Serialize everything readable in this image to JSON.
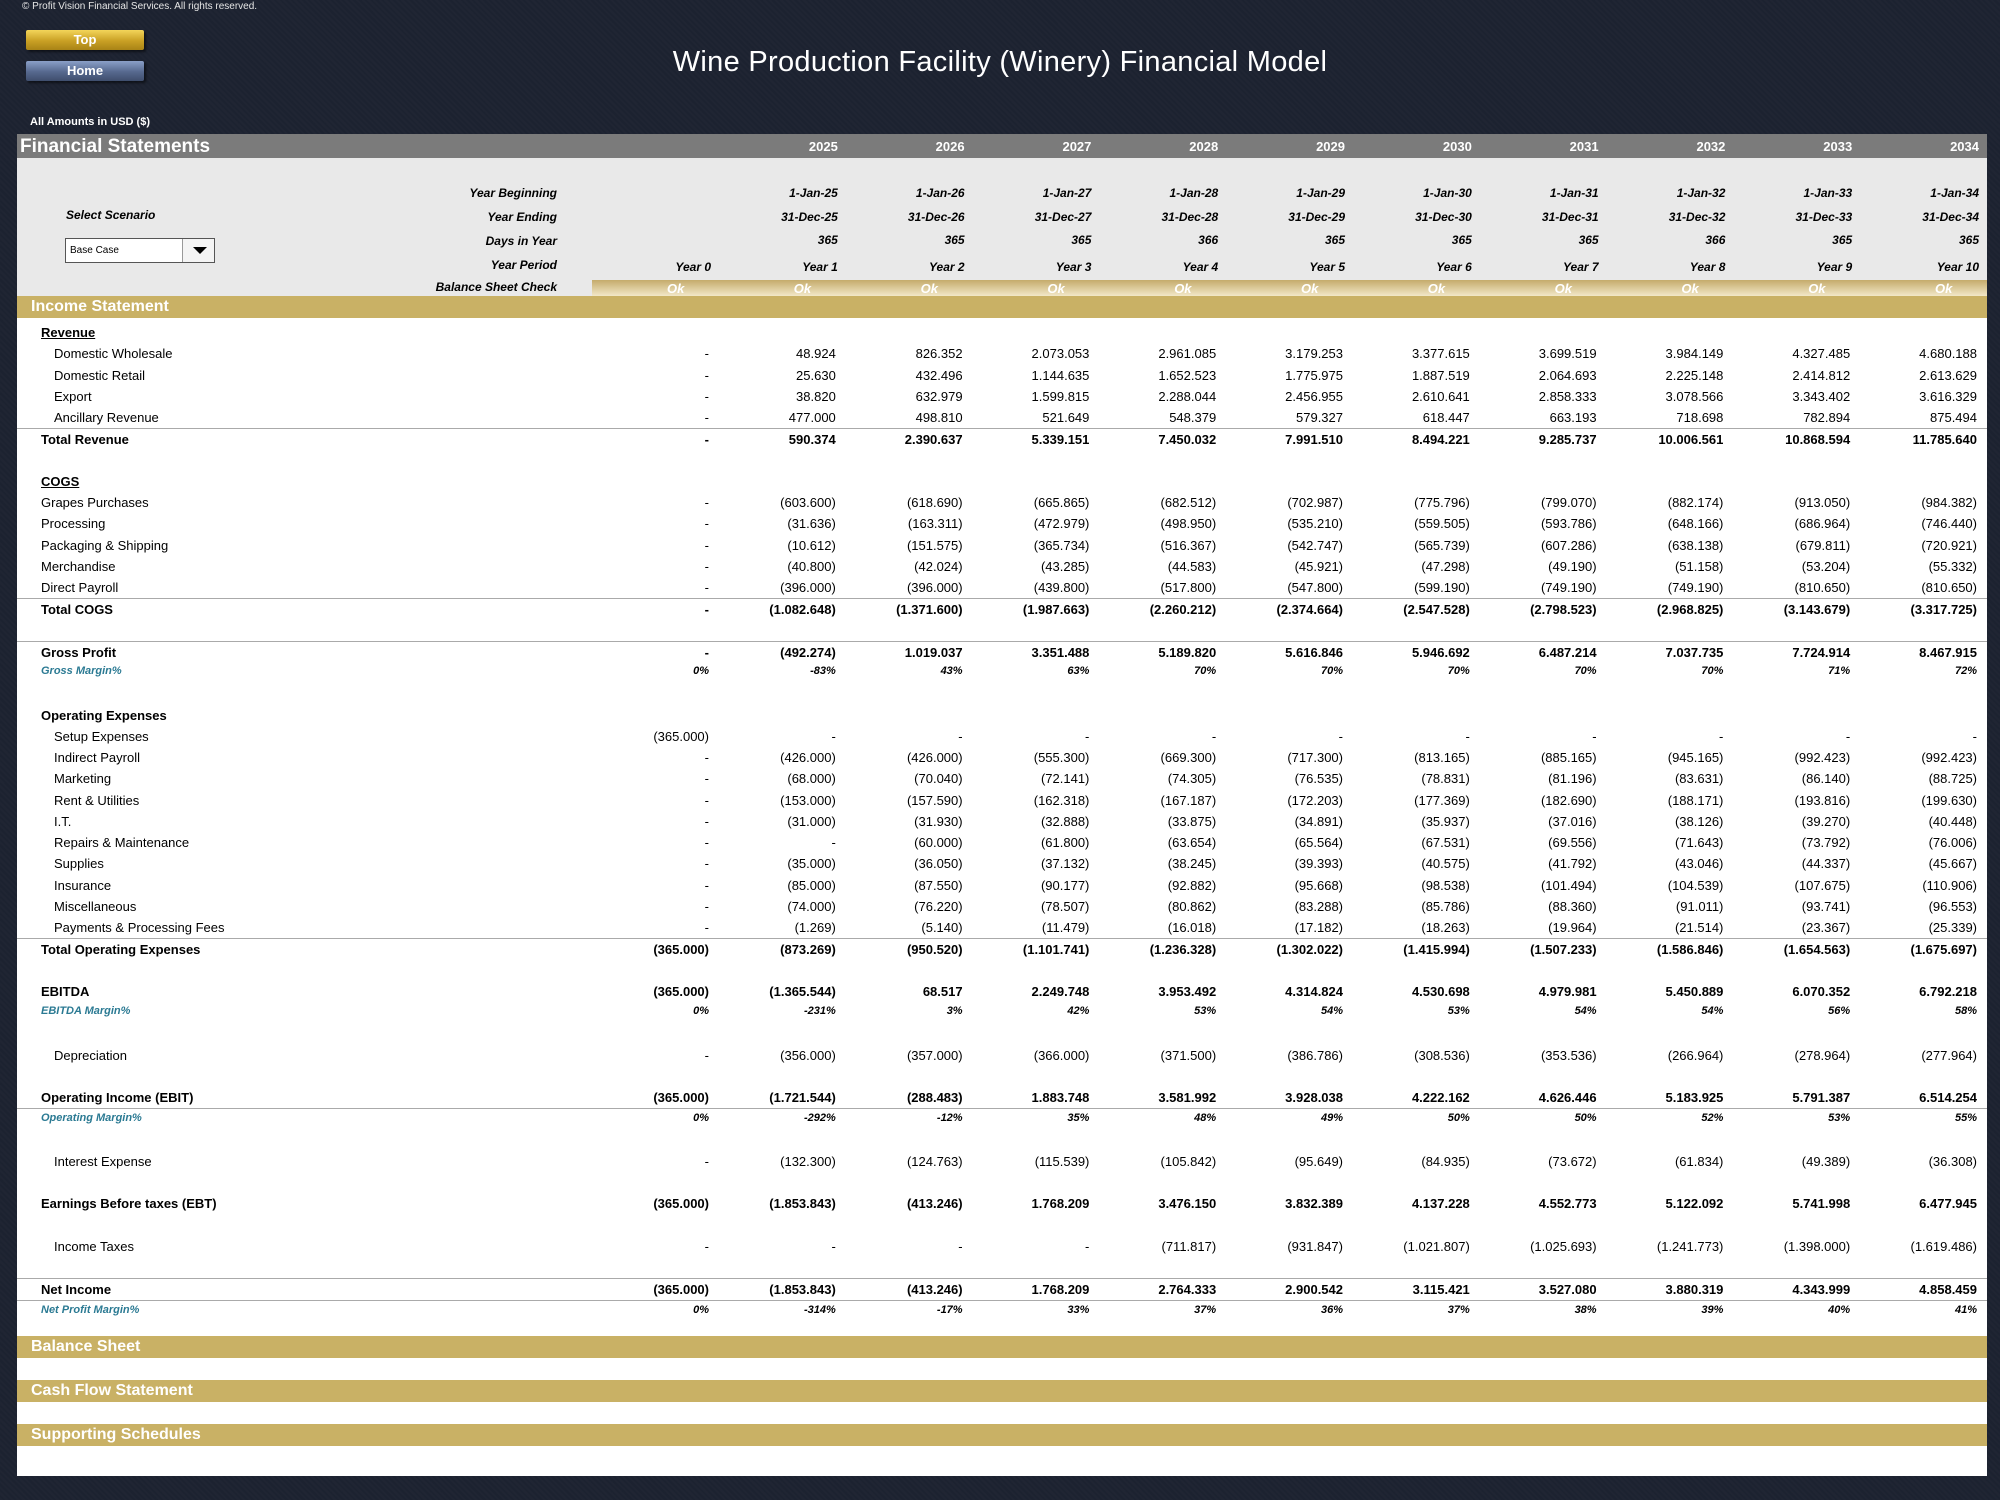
{
  "copyright": "© Profit Vision Financial Services. All rights reserved.",
  "nav": {
    "top": "Top",
    "home": "Home"
  },
  "title": "Wine Production Facility (Winery) Financial Model",
  "amounts_note": "All Amounts in  USD ($)",
  "header": {
    "section": "Financial Statements",
    "years": [
      "2025",
      "2026",
      "2027",
      "2028",
      "2029",
      "2030",
      "2031",
      "2032",
      "2033",
      "2034"
    ],
    "labels": {
      "year_beginning": "Year Beginning",
      "year_ending": "Year Ending",
      "days_in_year": "Days in Year",
      "year_period": "Year Period",
      "bs_check": "Balance Sheet Check",
      "select_scenario": "Select Scenario"
    },
    "year_beginning": [
      "1-Jan-25",
      "1-Jan-26",
      "1-Jan-27",
      "1-Jan-28",
      "1-Jan-29",
      "1-Jan-30",
      "1-Jan-31",
      "1-Jan-32",
      "1-Jan-33",
      "1-Jan-34"
    ],
    "year_ending": [
      "31-Dec-25",
      "31-Dec-26",
      "31-Dec-27",
      "31-Dec-28",
      "31-Dec-29",
      "31-Dec-30",
      "31-Dec-31",
      "31-Dec-32",
      "31-Dec-33",
      "31-Dec-34"
    ],
    "days": [
      "365",
      "365",
      "365",
      "366",
      "365",
      "365",
      "365",
      "366",
      "365",
      "365"
    ],
    "periods": [
      "Year 0",
      "Year 1",
      "Year 2",
      "Year 3",
      "Year 4",
      "Year 5",
      "Year 6",
      "Year 7",
      "Year 8",
      "Year 9",
      "Year 10"
    ],
    "checks": [
      "Ok",
      "Ok",
      "Ok",
      "Ok",
      "Ok",
      "Ok",
      "Ok",
      "Ok",
      "Ok",
      "Ok",
      "Ok"
    ],
    "scenario_value": "Base Case"
  },
  "income_statement": {
    "title": "Income Statement",
    "rows": [
      {
        "label": "Revenue",
        "style": "subhead"
      },
      {
        "label": "Domestic Wholesale",
        "style": "item",
        "values": [
          "-",
          "48.924",
          "826.352",
          "2.073.053",
          "2.961.085",
          "3.179.253",
          "3.377.615",
          "3.699.519",
          "3.984.149",
          "4.327.485",
          "4.680.188"
        ]
      },
      {
        "label": "Domestic Retail",
        "style": "item",
        "values": [
          "-",
          "25.630",
          "432.496",
          "1.144.635",
          "1.652.523",
          "1.775.975",
          "1.887.519",
          "2.064.693",
          "2.225.148",
          "2.414.812",
          "2.613.629"
        ]
      },
      {
        "label": "Export",
        "style": "item",
        "values": [
          "-",
          "38.820",
          "632.979",
          "1.599.815",
          "2.288.044",
          "2.456.955",
          "2.610.641",
          "2.858.333",
          "3.078.566",
          "3.343.402",
          "3.616.329"
        ]
      },
      {
        "label": "Ancillary Revenue",
        "style": "item",
        "values": [
          "-",
          "477.000",
          "498.810",
          "521.649",
          "548.379",
          "579.327",
          "618.447",
          "663.193",
          "718.698",
          "782.894",
          "875.494"
        ]
      },
      {
        "label": "Total Revenue",
        "style": "total",
        "values": [
          "-",
          "590.374",
          "2.390.637",
          "5.339.151",
          "7.450.032",
          "7.991.510",
          "8.494.221",
          "9.285.737",
          "10.006.561",
          "10.868.594",
          "11.785.640"
        ]
      },
      {
        "style": "blank"
      },
      {
        "label": "COGS",
        "style": "subhead"
      },
      {
        "label": "Grapes Purchases",
        "style": "flat",
        "values": [
          "-",
          "(603.600)",
          "(618.690)",
          "(665.865)",
          "(682.512)",
          "(702.987)",
          "(775.796)",
          "(799.070)",
          "(882.174)",
          "(913.050)",
          "(984.382)"
        ]
      },
      {
        "label": "Processing",
        "style": "flat",
        "values": [
          "-",
          "(31.636)",
          "(163.311)",
          "(472.979)",
          "(498.950)",
          "(535.210)",
          "(559.505)",
          "(593.786)",
          "(648.166)",
          "(686.964)",
          "(746.440)"
        ]
      },
      {
        "label": "Packaging & Shipping",
        "style": "flat",
        "values": [
          "-",
          "(10.612)",
          "(151.575)",
          "(365.734)",
          "(516.367)",
          "(542.747)",
          "(565.739)",
          "(607.286)",
          "(638.138)",
          "(679.811)",
          "(720.921)"
        ]
      },
      {
        "label": "Merchandise",
        "style": "flat",
        "values": [
          "-",
          "(40.800)",
          "(42.024)",
          "(43.285)",
          "(44.583)",
          "(45.921)",
          "(47.298)",
          "(49.190)",
          "(51.158)",
          "(53.204)",
          "(55.332)"
        ]
      },
      {
        "label": "Direct Payroll",
        "style": "flat",
        "values": [
          "-",
          "(396.000)",
          "(396.000)",
          "(439.800)",
          "(517.800)",
          "(547.800)",
          "(599.190)",
          "(749.190)",
          "(749.190)",
          "(810.650)",
          "(810.650)"
        ]
      },
      {
        "label": "Total COGS",
        "style": "total",
        "values": [
          "-",
          "(1.082.648)",
          "(1.371.600)",
          "(1.987.663)",
          "(2.260.212)",
          "(2.374.664)",
          "(2.547.528)",
          "(2.798.523)",
          "(2.968.825)",
          "(3.143.679)",
          "(3.317.725)"
        ]
      },
      {
        "style": "blank"
      },
      {
        "label": "Gross Profit",
        "style": "total",
        "values": [
          "-",
          "(492.274)",
          "1.019.037",
          "3.351.488",
          "5.189.820",
          "5.616.846",
          "5.946.692",
          "6.487.214",
          "7.037.735",
          "7.724.914",
          "8.467.915"
        ]
      },
      {
        "label": "Gross Margin%",
        "style": "pct",
        "values": [
          "0%",
          "-83%",
          "43%",
          "63%",
          "70%",
          "70%",
          "70%",
          "70%",
          "70%",
          "71%",
          "72%"
        ]
      },
      {
        "style": "blank"
      },
      {
        "label": "Operating Expenses",
        "style": "boldhead"
      },
      {
        "label": "Setup Expenses",
        "style": "item",
        "values": [
          "(365.000)",
          "-",
          "-",
          "-",
          "-",
          "-",
          "-",
          "-",
          "-",
          "-",
          "-"
        ]
      },
      {
        "label": "Indirect Payroll",
        "style": "item",
        "values": [
          "-",
          "(426.000)",
          "(426.000)",
          "(555.300)",
          "(669.300)",
          "(717.300)",
          "(813.165)",
          "(885.165)",
          "(945.165)",
          "(992.423)",
          "(992.423)"
        ]
      },
      {
        "label": "Marketing",
        "style": "item",
        "values": [
          "-",
          "(68.000)",
          "(70.040)",
          "(72.141)",
          "(74.305)",
          "(76.535)",
          "(78.831)",
          "(81.196)",
          "(83.631)",
          "(86.140)",
          "(88.725)"
        ]
      },
      {
        "label": "Rent & Utilities",
        "style": "item",
        "values": [
          "-",
          "(153.000)",
          "(157.590)",
          "(162.318)",
          "(167.187)",
          "(172.203)",
          "(177.369)",
          "(182.690)",
          "(188.171)",
          "(193.816)",
          "(199.630)"
        ]
      },
      {
        "label": "I.T.",
        "style": "item",
        "values": [
          "-",
          "(31.000)",
          "(31.930)",
          "(32.888)",
          "(33.875)",
          "(34.891)",
          "(35.937)",
          "(37.016)",
          "(38.126)",
          "(39.270)",
          "(40.448)"
        ]
      },
      {
        "label": "Repairs & Maintenance",
        "style": "item",
        "values": [
          "-",
          "-",
          "(60.000)",
          "(61.800)",
          "(63.654)",
          "(65.564)",
          "(67.531)",
          "(69.556)",
          "(71.643)",
          "(73.792)",
          "(76.006)"
        ]
      },
      {
        "label": "Supplies",
        "style": "item",
        "values": [
          "-",
          "(35.000)",
          "(36.050)",
          "(37.132)",
          "(38.245)",
          "(39.393)",
          "(40.575)",
          "(41.792)",
          "(43.046)",
          "(44.337)",
          "(45.667)"
        ]
      },
      {
        "label": "Insurance",
        "style": "item",
        "values": [
          "-",
          "(85.000)",
          "(87.550)",
          "(90.177)",
          "(92.882)",
          "(95.668)",
          "(98.538)",
          "(101.494)",
          "(104.539)",
          "(107.675)",
          "(110.906)"
        ]
      },
      {
        "label": "Miscellaneous",
        "style": "item",
        "values": [
          "-",
          "(74.000)",
          "(76.220)",
          "(78.507)",
          "(80.862)",
          "(83.288)",
          "(85.786)",
          "(88.360)",
          "(91.011)",
          "(93.741)",
          "(96.553)"
        ]
      },
      {
        "label": "Payments & Processing Fees",
        "style": "item",
        "values": [
          "-",
          "(1.269)",
          "(5.140)",
          "(11.479)",
          "(16.018)",
          "(17.182)",
          "(18.263)",
          "(19.964)",
          "(21.514)",
          "(23.367)",
          "(25.339)"
        ]
      },
      {
        "label": "Total Operating Expenses",
        "style": "total",
        "values": [
          "(365.000)",
          "(873.269)",
          "(950.520)",
          "(1.101.741)",
          "(1.236.328)",
          "(1.302.022)",
          "(1.415.994)",
          "(1.507.233)",
          "(1.586.846)",
          "(1.654.563)",
          "(1.675.697)"
        ]
      },
      {
        "style": "blank"
      },
      {
        "label": "EBITDA",
        "style": "boldrow",
        "values": [
          "(365.000)",
          "(1.365.544)",
          "68.517",
          "2.249.748",
          "3.953.492",
          "4.314.824",
          "4.530.698",
          "4.979.981",
          "5.450.889",
          "6.070.352",
          "6.792.218"
        ]
      },
      {
        "label": "EBITDA Margin%",
        "style": "pct",
        "values": [
          "0%",
          "-231%",
          "3%",
          "42%",
          "53%",
          "54%",
          "53%",
          "54%",
          "54%",
          "56%",
          "58%"
        ]
      },
      {
        "style": "blank"
      },
      {
        "label": "Depreciation",
        "style": "item",
        "values": [
          "-",
          "(356.000)",
          "(357.000)",
          "(366.000)",
          "(371.500)",
          "(386.786)",
          "(308.536)",
          "(353.536)",
          "(266.964)",
          "(278.964)",
          "(277.964)"
        ]
      },
      {
        "style": "blank"
      },
      {
        "label": "Operating Income (EBIT)",
        "style": "boldrow",
        "values": [
          "(365.000)",
          "(1.721.544)",
          "(288.483)",
          "1.883.748",
          "3.581.992",
          "3.928.038",
          "4.222.162",
          "4.626.446",
          "5.183.925",
          "5.791.387",
          "6.514.254"
        ]
      },
      {
        "label": "Operating Margin%",
        "style": "pctline",
        "values": [
          "0%",
          "-292%",
          "-12%",
          "35%",
          "48%",
          "49%",
          "50%",
          "50%",
          "52%",
          "53%",
          "55%"
        ]
      },
      {
        "style": "blank"
      },
      {
        "label": "Interest Expense",
        "style": "item",
        "values": [
          "-",
          "(132.300)",
          "(124.763)",
          "(115.539)",
          "(105.842)",
          "(95.649)",
          "(84.935)",
          "(73.672)",
          "(61.834)",
          "(49.389)",
          "(36.308)"
        ]
      },
      {
        "style": "blank"
      },
      {
        "label": "Earnings Before taxes (EBT)",
        "style": "boldrow",
        "values": [
          "(365.000)",
          "(1.853.843)",
          "(413.246)",
          "1.768.209",
          "3.476.150",
          "3.832.389",
          "4.137.228",
          "4.552.773",
          "5.122.092",
          "5.741.998",
          "6.477.945"
        ]
      },
      {
        "style": "blank"
      },
      {
        "label": "Income Taxes",
        "style": "item",
        "values": [
          "-",
          "-",
          "-",
          "-",
          "(711.817)",
          "(931.847)",
          "(1.021.807)",
          "(1.025.693)",
          "(1.241.773)",
          "(1.398.000)",
          "(1.619.486)"
        ]
      },
      {
        "style": "blank"
      },
      {
        "label": "Net Income",
        "style": "total",
        "values": [
          "(365.000)",
          "(1.853.843)",
          "(413.246)",
          "1.768.209",
          "2.764.333",
          "2.900.542",
          "3.115.421",
          "3.527.080",
          "3.880.319",
          "4.343.999",
          "4.858.459"
        ]
      },
      {
        "label": "Net Profit Margin%",
        "style": "pctline",
        "values": [
          "0%",
          "-314%",
          "-17%",
          "33%",
          "37%",
          "36%",
          "37%",
          "38%",
          "39%",
          "40%",
          "41%"
        ]
      }
    ]
  },
  "sections": [
    "Balance Sheet",
    "Cash Flow Statement",
    "Supporting Schedules"
  ]
}
